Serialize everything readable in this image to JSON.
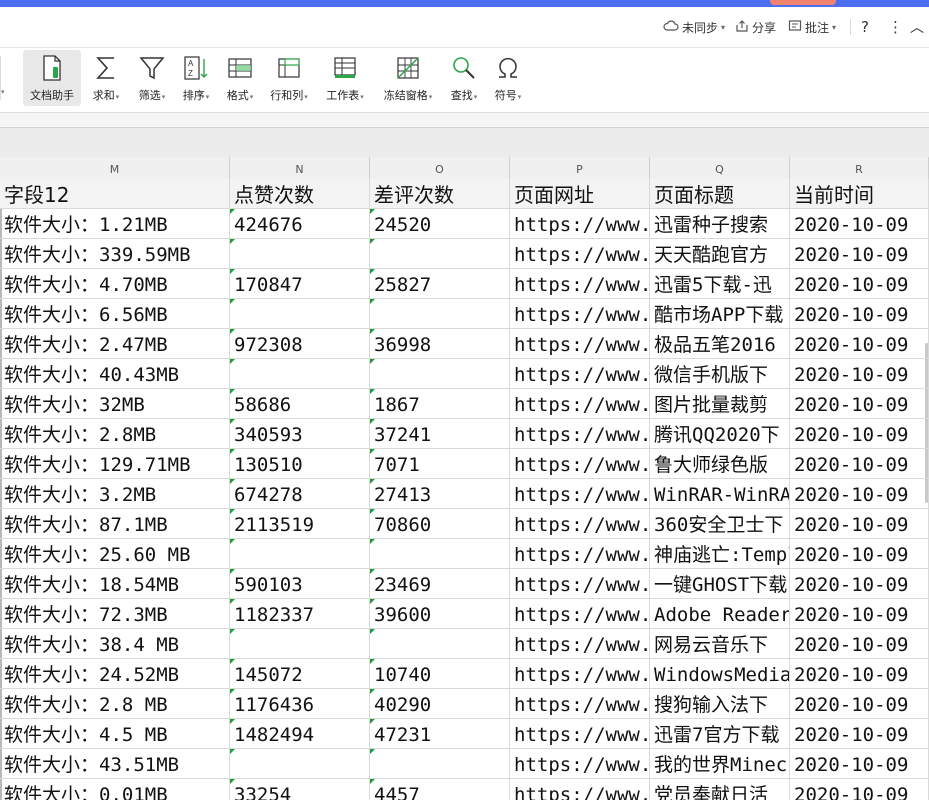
{
  "toolbar_top": {
    "sync_label": "未同步",
    "share_label": "分享",
    "comment_label": "批注",
    "help_label": "?",
    "more_label": "⋮",
    "collapse_label": "︿"
  },
  "ribbon": {
    "buttons": [
      {
        "label": "文档助手",
        "icon": "document-assistant-icon"
      },
      {
        "label": "求和",
        "icon": "sum-icon"
      },
      {
        "label": "筛选",
        "icon": "filter-icon"
      },
      {
        "label": "排序",
        "icon": "sort-icon"
      },
      {
        "label": "格式",
        "icon": "format-icon"
      },
      {
        "label": "行和列",
        "icon": "rows-columns-icon"
      },
      {
        "label": "工作表",
        "icon": "worksheet-icon"
      },
      {
        "label": "冻结窗格",
        "icon": "freeze-panes-icon"
      },
      {
        "label": "查找",
        "icon": "search-icon"
      },
      {
        "label": "符号",
        "icon": "symbol-icon"
      }
    ]
  },
  "columns": [
    "M",
    "N",
    "O",
    "P",
    "Q",
    "R"
  ],
  "header_row": [
    "字段12",
    "点赞次数",
    "差评次数",
    "页面网址",
    "页面标题",
    "当前时间"
  ],
  "rows": [
    [
      "软件大小：1.21MB",
      "424676",
      "24520",
      "https://www.",
      "迅雷种子搜索",
      "2020-10-09"
    ],
    [
      "软件大小：339.59MB",
      "",
      "",
      "https://www.",
      "天天酷跑官方",
      "2020-10-09"
    ],
    [
      "软件大小：4.70MB",
      "170847",
      "25827",
      "https://www.",
      "迅雷5下载-迅",
      "2020-10-09"
    ],
    [
      "软件大小：6.56MB",
      "",
      "",
      "https://www.",
      "酷市场APP下载",
      "2020-10-09"
    ],
    [
      "软件大小：2.47MB",
      "972308",
      "36998",
      "https://www.",
      "极品五笔2016",
      "2020-10-09"
    ],
    [
      "软件大小：40.43MB",
      "",
      "",
      "https://www.",
      "微信手机版下",
      "2020-10-09"
    ],
    [
      "软件大小：32MB",
      "58686",
      "1867",
      "https://www.",
      "图片批量裁剪",
      "2020-10-09"
    ],
    [
      "软件大小：2.8MB",
      "340593",
      "37241",
      "https://www.",
      "腾讯QQ2020下",
      "2020-10-09"
    ],
    [
      "软件大小：129.71MB",
      "130510",
      "7071",
      "https://www.",
      "鲁大师绿色版",
      "2020-10-09"
    ],
    [
      "软件大小：3.2MB",
      "674278",
      "27413",
      "https://www.",
      "WinRAR-WinRAR",
      "2020-10-09"
    ],
    [
      "软件大小：87.1MB",
      "2113519",
      "70860",
      "https://www.",
      "360安全卫士下",
      "2020-10-09"
    ],
    [
      "软件大小：25.60 MB",
      "",
      "",
      "https://www.",
      "神庙逃亡:Temple",
      "2020-10-09"
    ],
    [
      "软件大小：18.54MB",
      "590103",
      "23469",
      "https://www.",
      "一键GHOST下载",
      "2020-10-09"
    ],
    [
      "软件大小：72.3MB",
      "1182337",
      "39600",
      "https://www.",
      "Adobe Reader",
      "2020-10-09"
    ],
    [
      "软件大小：38.4 MB",
      "",
      "",
      "https://www.",
      "网易云音乐下",
      "2020-10-09"
    ],
    [
      "软件大小：24.52MB",
      "145072",
      "10740",
      "https://www.",
      "WindowsMedia",
      "2020-10-09"
    ],
    [
      "软件大小：2.8 MB",
      "1176436",
      "40290",
      "https://www.",
      "搜狗输入法下",
      "2020-10-09"
    ],
    [
      "软件大小：4.5 MB",
      "1482494",
      "47231",
      "https://www.",
      "迅雷7官方下载",
      "2020-10-09"
    ],
    [
      "软件大小：43.51MB",
      "",
      "",
      "https://www.",
      "我的世界Minecraft",
      "2020-10-09"
    ],
    [
      "软件大小：0.01MB",
      "33254",
      "4457",
      "https://www.",
      "党员奉献日活",
      "2020-10-09"
    ]
  ]
}
